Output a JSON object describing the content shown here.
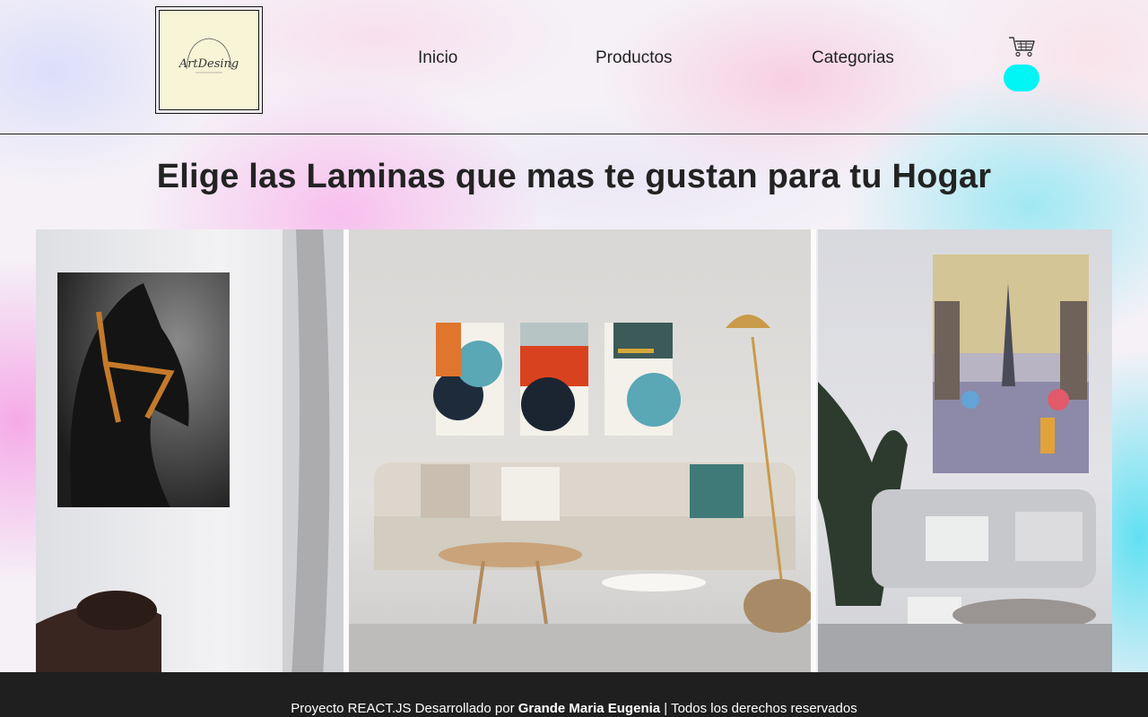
{
  "header": {
    "logo_text": "ArtDesing",
    "nav": [
      {
        "label": "Inicio"
      },
      {
        "label": "Productos"
      },
      {
        "label": "Categorias"
      }
    ],
    "cart_icon": "cart-icon",
    "accent_color": "#00f5f5"
  },
  "hero": {
    "title": "Elige las Laminas que mas te gustan para tu Hogar"
  },
  "footer": {
    "prefix": "Proyecto REACT.JS Desarrollado por ",
    "author": "Grande Maria Eugenia",
    "suffix": " | Todos los derechos reservados"
  }
}
